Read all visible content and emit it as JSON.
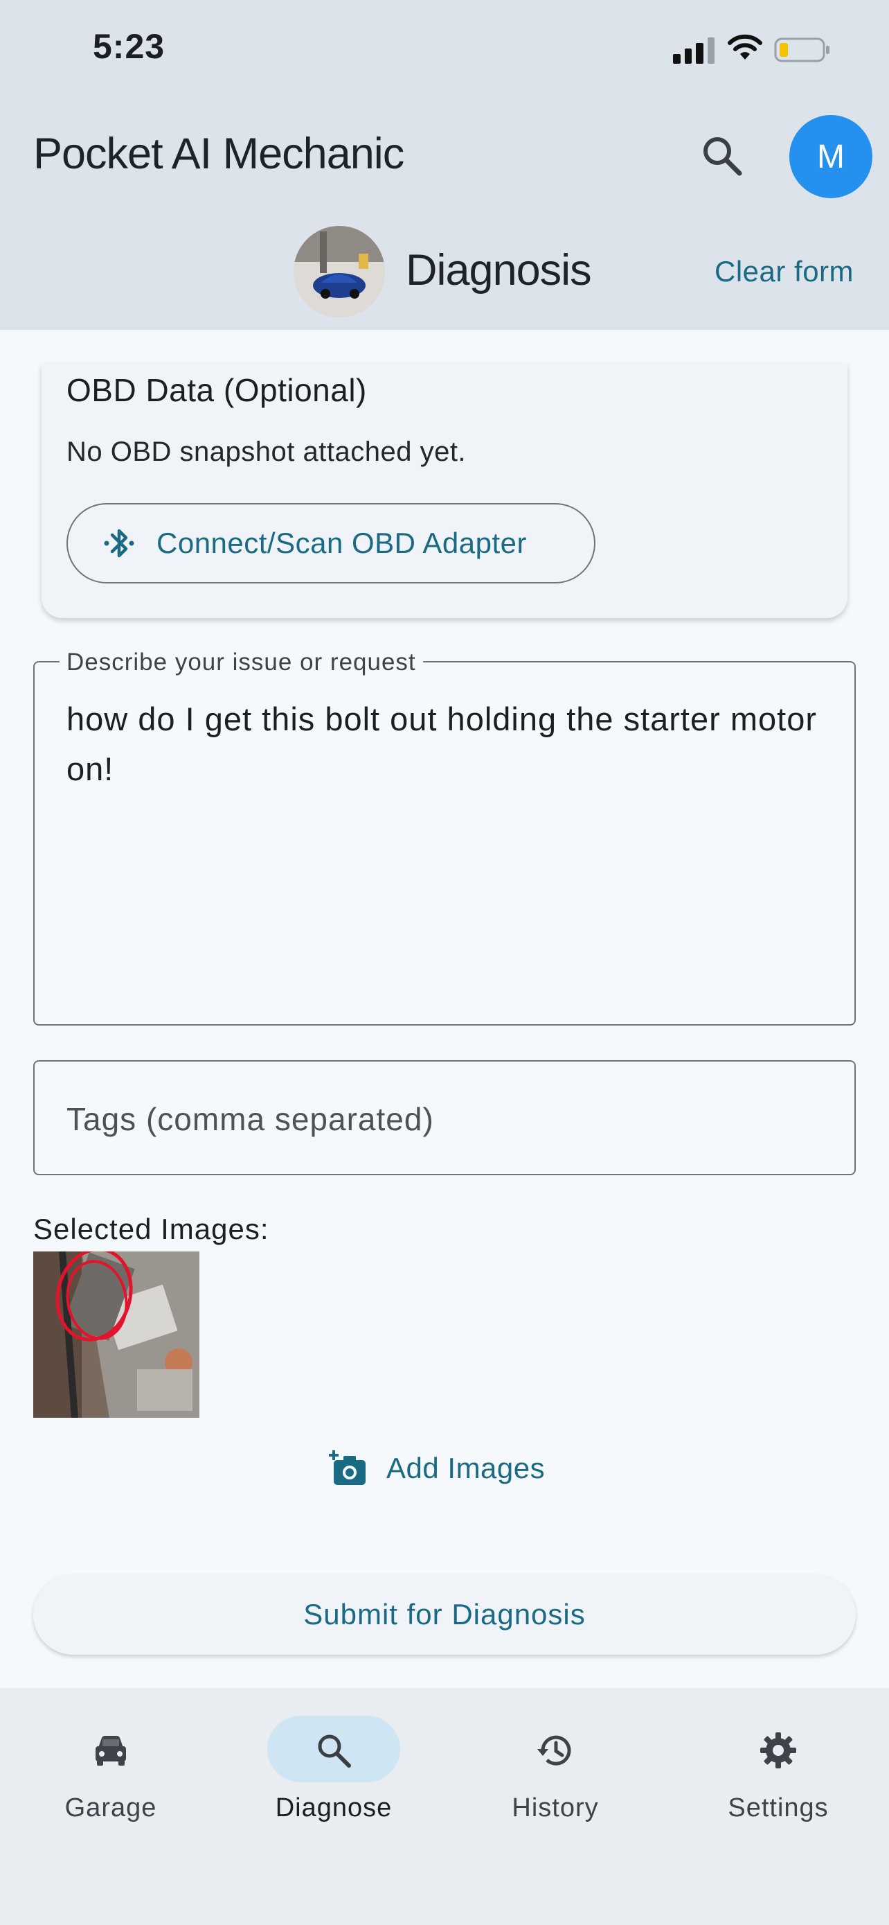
{
  "status_bar": {
    "time": "5:23"
  },
  "app_bar": {
    "title": "Pocket AI Mechanic",
    "avatar_initial": "M"
  },
  "sub_header": {
    "title": "Diagnosis",
    "clear_label": "Clear form"
  },
  "obd": {
    "title": "OBD Data (Optional)",
    "status": "No OBD snapshot attached yet.",
    "button_label": "Connect/Scan OBD Adapter"
  },
  "description": {
    "label": "Describe your issue or request",
    "value": "how do I get this bolt out holding the starter motor on!"
  },
  "tags": {
    "placeholder": "Tags (comma separated)"
  },
  "images": {
    "label": "Selected Images:",
    "add_label": "Add Images"
  },
  "submit": {
    "label": "Submit for Diagnosis"
  },
  "nav": {
    "items": [
      {
        "label": "Garage",
        "icon": "car-icon"
      },
      {
        "label": "Diagnose",
        "icon": "search-icon",
        "active": true
      },
      {
        "label": "History",
        "icon": "history-icon"
      },
      {
        "label": "Settings",
        "icon": "gear-icon"
      }
    ]
  },
  "colors": {
    "accent": "#1a6a84",
    "avatar": "#2491ee",
    "active_pill": "#cfe5f3",
    "app_bar": "#dce3ea"
  }
}
